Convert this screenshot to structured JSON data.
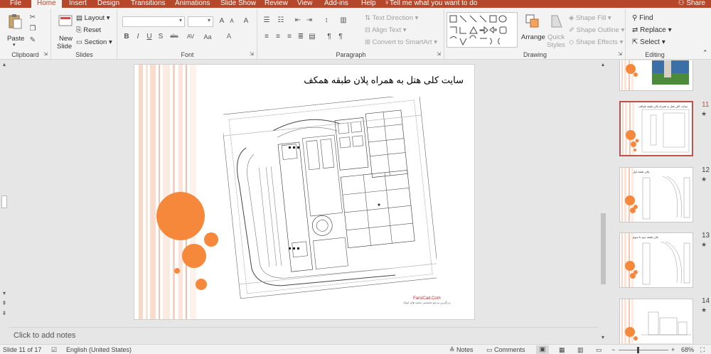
{
  "tabs": [
    "File",
    "Home",
    "Insert",
    "Design",
    "Transitions",
    "Animations",
    "Slide Show",
    "Review",
    "View",
    "Add-ins",
    "Help"
  ],
  "active_tab": "Home",
  "tell_me": "Tell me what you want to do",
  "share": "Share",
  "ribbon": {
    "clipboard": {
      "paste": "Paste",
      "label": "Clipboard"
    },
    "slides": {
      "new_slide": "New",
      "new_slide2": "Slide",
      "layout": "Layout",
      "reset": "Reset",
      "section": "Section",
      "label": "Slides"
    },
    "font": {
      "label": "Font",
      "bold": "B",
      "italic": "I",
      "underline": "U",
      "strike": "S",
      "shadow": "abc",
      "spacing": "AV",
      "case": "Aa"
    },
    "paragraph": {
      "label": "Paragraph",
      "text_direction": "Text Direction",
      "align_text": "Align Text",
      "smartart": "Convert to SmartArt"
    },
    "drawing": {
      "label": "Drawing",
      "arrange": "Arrange",
      "quick_styles": "Quick",
      "quick_styles2": "Styles",
      "shape_fill": "Shape Fill",
      "shape_outline": "Shape Outline",
      "shape_effects": "Shape Effects"
    },
    "editing": {
      "label": "Editing",
      "find": "Find",
      "replace": "Replace",
      "select": "Select"
    }
  },
  "slide": {
    "title": "سایت کلی هتل به همراه پلان طبقه همکف",
    "watermark1": "FarsiCad.Com",
    "watermark2": "بزرگترین مرجع تخصصی نقشه های اتوکد"
  },
  "notes_placeholder": "Click to add notes",
  "thumbnails": [
    {
      "num": "",
      "star": ""
    },
    {
      "num": "11",
      "star": "★",
      "title": "سایت کلی هتل به همراه پلان طبقه همکف"
    },
    {
      "num": "12",
      "star": "★",
      "title": "پلان طبقه اول"
    },
    {
      "num": "13",
      "star": "★",
      "title": "پلان طبقه دوم تا سوم"
    },
    {
      "num": "14",
      "star": "★",
      "title": ""
    }
  ],
  "status": {
    "slide_of": "Slide 11 of 17",
    "language": "English (United States)",
    "notes": "Notes",
    "comments": "Comments",
    "zoom": "68%"
  },
  "colors": {
    "accent": "#b7472a",
    "orange": "#f5883b",
    "stripe": "#f7c9b5"
  }
}
